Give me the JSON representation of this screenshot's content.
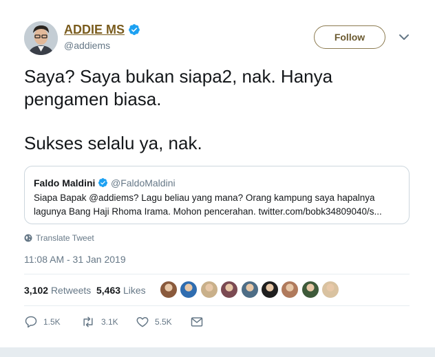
{
  "author": {
    "name": "ADDIE MS",
    "handle": "@addiems",
    "verified": true
  },
  "follow_label": "Follow",
  "tweet": {
    "line1": "Saya? Saya bukan siapa2, nak. Hanya",
    "line2": "pengamen biasa.",
    "line3": "Sukses selalu ya, nak."
  },
  "quoted": {
    "name": "Faldo Maldini",
    "handle": "@FaldoMaldini",
    "text": "Siapa Bapak @addiems? Lagu beliau yang mana? Orang kampung saya hapalnya lagunya Bang Haji Rhoma Irama. Mohon pencerahan. twitter.com/bobk34809040/s..."
  },
  "translate_label": "Translate Tweet",
  "timestamp": "11:08 AM - 31 Jan 2019",
  "stats": {
    "retweets_count": "3,102",
    "retweets_label": "Retweets",
    "likes_count": "5,463",
    "likes_label": "Likes"
  },
  "likers_colors": [
    "#8a5a3c",
    "#2f6db0",
    "#c9b08a",
    "#7b4a52",
    "#4d6d86",
    "#1f1f1f",
    "#b07a5c",
    "#3e5a3a",
    "#d9c2a0"
  ],
  "actions": {
    "reply_count": "1.5K",
    "retweet_count": "3.1K",
    "like_count": "5.5K"
  },
  "colors": {
    "brand_gold": "#7a5c1e",
    "verified_blue": "#1da1f2",
    "secondary_text": "#657786"
  }
}
